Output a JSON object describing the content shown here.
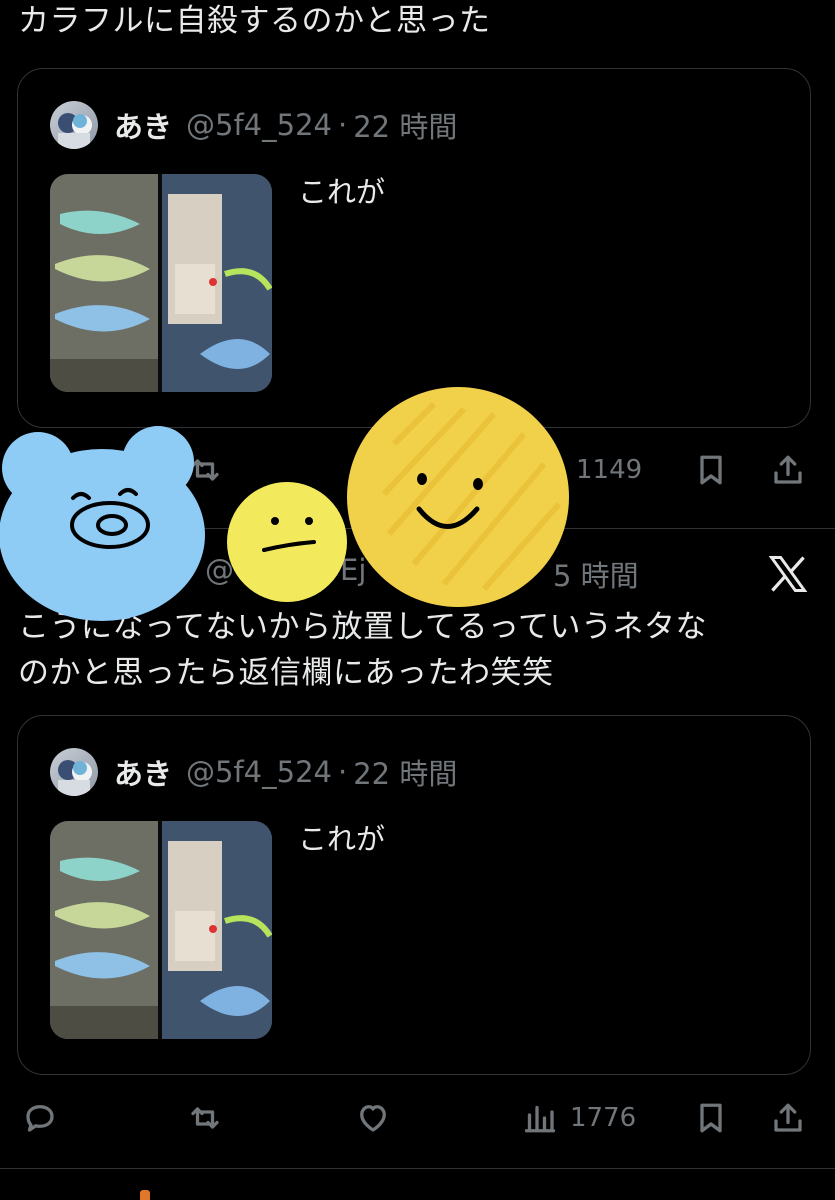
{
  "post1": {
    "text": "カラフルに自殺するのかと思った",
    "quote": {
      "name": "あき",
      "handle": "@5f4_524",
      "dot": "·",
      "time": "22 時間",
      "text": "これが"
    },
    "actions": {
      "views": "1149"
    }
  },
  "post2": {
    "meta_partial_1": "@",
    "meta_partial_2": "Ej",
    "meta_partial_3": "5 時間",
    "text_line1": "こうになってないから放置してるっていうネタな",
    "text_line2": "のかと思ったら返信欄にあったわ笑笑",
    "quote": {
      "name": "あき",
      "handle": "@5f4_524",
      "dot": "·",
      "time": "22 時間",
      "text": "これが"
    },
    "actions": {
      "views": "1776"
    }
  },
  "icons": {
    "reply": "reply-icon",
    "repost": "repost-icon",
    "like": "like-icon",
    "views": "views-icon",
    "bookmark": "bookmark-icon",
    "share": "share-icon",
    "brand": "x-logo-icon"
  },
  "colors": {
    "background": "#000000",
    "text": "#e7e9ea",
    "secondary": "#71767b",
    "border": "#2f3336",
    "sticker_blue": "#8ecbf5",
    "sticker_yellow": "#f2ea5c",
    "sticker_gold": "#f2d14a"
  }
}
